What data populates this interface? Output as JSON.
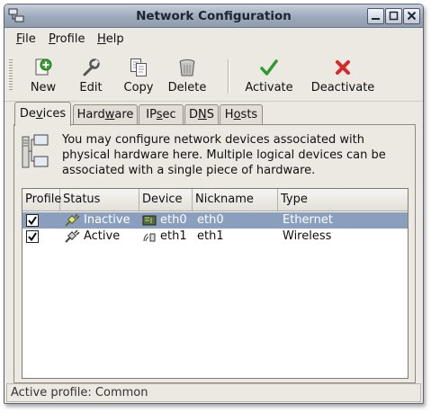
{
  "window": {
    "title": "Network Configuration"
  },
  "menubar": [
    {
      "label": "File",
      "mnemonic": "F",
      "rest": "ile"
    },
    {
      "label": "Profile",
      "mnemonic": "P",
      "rest": "rofile"
    },
    {
      "label": "Help",
      "mnemonic": "H",
      "rest": "elp"
    }
  ],
  "toolbar": {
    "new": {
      "label": "New",
      "icon": "new-device-icon"
    },
    "edit": {
      "label": "Edit",
      "icon": "wrench-icon"
    },
    "copy": {
      "label": "Copy",
      "icon": "copy-icon"
    },
    "delete": {
      "label": "Delete",
      "icon": "trash-icon"
    },
    "activate": {
      "label": "Activate",
      "icon": "check-icon",
      "color": "#2f9a2f"
    },
    "deactivate": {
      "label": "Deactivate",
      "icon": "x-icon",
      "color": "#d42a2a"
    }
  },
  "tabs": [
    {
      "pre": "De",
      "u": "v",
      "post": "ices",
      "active": true
    },
    {
      "pre": "Hard",
      "u": "w",
      "post": "are"
    },
    {
      "pre": "IP",
      "u": "s",
      "post": "ec"
    },
    {
      "pre": "D",
      "u": "N",
      "post": "S"
    },
    {
      "pre": "H",
      "u": "o",
      "post": "sts"
    }
  ],
  "info": {
    "text": "You may configure network devices associated with physical hardware here.  Multiple logical devices can be associated with a single piece of hardware."
  },
  "table": {
    "columns": {
      "profile": "Profile",
      "status": "Status",
      "device": "Device",
      "nickname": "Nickname",
      "type": "Type"
    },
    "rows": [
      {
        "profile_checked": true,
        "status": "Inactive",
        "device": "eth0",
        "nickname": "eth0",
        "type": "Ethernet",
        "selected": true
      },
      {
        "profile_checked": true,
        "status": "Active",
        "device": "eth1",
        "nickname": "eth1",
        "type": "Wireless",
        "selected": false
      }
    ]
  },
  "statusbar": {
    "text": "Active profile: Common"
  }
}
